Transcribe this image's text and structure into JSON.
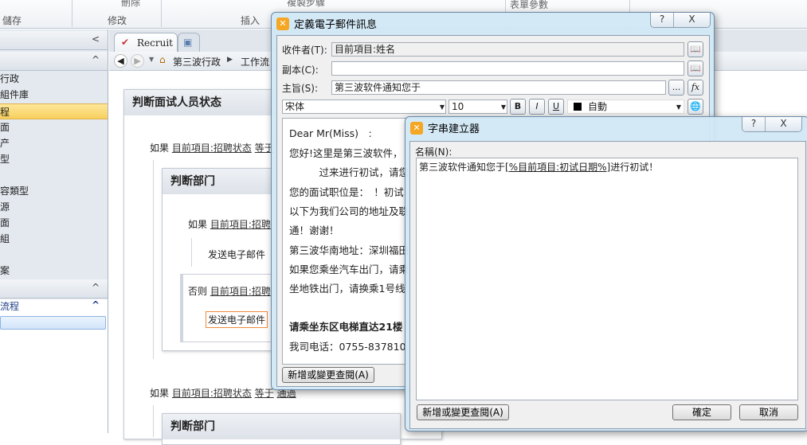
{
  "ribbon": {
    "groups": [
      "儲存",
      "修改",
      "插入"
    ],
    "top_items": [
      "刪除",
      "複製步驟",
      "表單參數"
    ]
  },
  "left_panel": {
    "items": [
      "行政",
      "組件庫",
      "程",
      "面",
      "产",
      "型",
      "容類型",
      "源",
      "面",
      "組",
      "案"
    ],
    "section_label": "流程"
  },
  "tabs": [
    {
      "label": "Recruit"
    }
  ],
  "breadcrumb": [
    "第三波行政",
    "工作流"
  ],
  "workflow": {
    "title": "判断面试人员状态",
    "if_label": "如果",
    "else_label": "否则",
    "condition_field": "目前項目:招聘状态",
    "condition_op": "等于",
    "condition_value": "通過",
    "sub_title": "判断部门",
    "cond_short": "目前項目:招聘",
    "action": "发送电子邮件"
  },
  "email_dialog": {
    "title": "定義電子郵件訊息",
    "to_label": "收件者(T):",
    "to_value": "目前項目:姓名",
    "cc_label": "副本(C):",
    "cc_value": "",
    "subject_label": "主旨(S):",
    "subject_value": "第三波软件通知您于",
    "more_btn": "...",
    "fx_btn": "fx",
    "font": "宋体",
    "size": "10",
    "bold": "B",
    "italic": "I",
    "underline": "U",
    "color_label": "自動",
    "body_lines": [
      "Dear Mr(Miss)　:",
      "您好!这里是第三波软件，",
      "　　　过来进行初试，请您",
      "您的面试职位是：　！初试",
      "以下为我们公司的地址及联",
      "通！谢谢！",
      "第三波华南地址：深圳福田",
      "如果您乘坐汽车出门，请乘",
      "坐地铁出门，请换乘1号线",
      "",
      "请乘坐东区电梯直达21楼",
      "我司电话：0755-837810"
    ],
    "lookup_btn": "新增或變更查閱(A)"
  },
  "string_builder": {
    "title": "字串建立器",
    "name_label": "名稱(N):",
    "text_prefix": "第三波软件通知您于",
    "text_lookup": "[%目前項目:初试日期%]",
    "text_suffix": "进行初试！",
    "lookup_btn": "新增或變更查閱(A)",
    "ok": "確定",
    "cancel": "取消",
    "help": "?",
    "close": "X"
  }
}
